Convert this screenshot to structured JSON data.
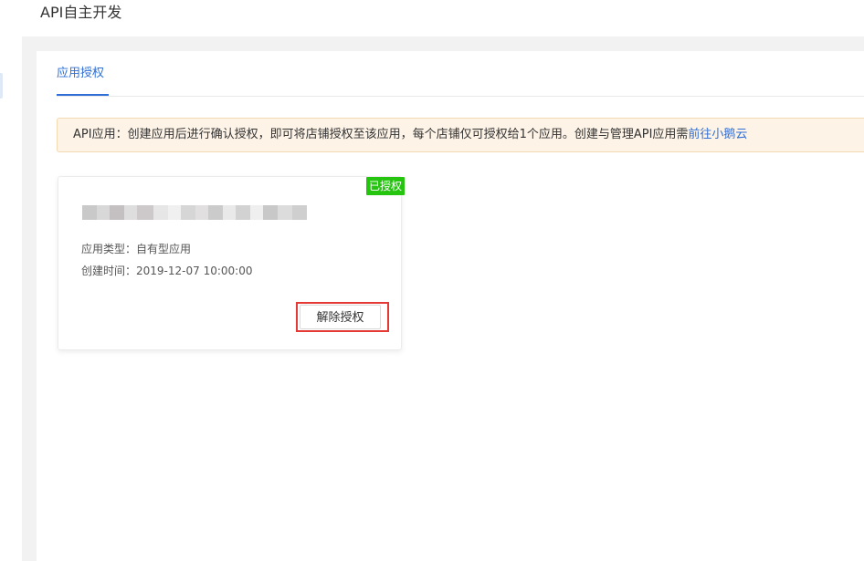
{
  "page": {
    "title": "API自主开发"
  },
  "tabs": [
    {
      "label": "应用授权",
      "active": true
    }
  ],
  "notice": {
    "text": "API应用：创建应用后进行确认授权，即可将店铺授权至该应用，每个店铺仅可授权给1个应用。创建与管理API应用需",
    "link_text": "前往小鹅云"
  },
  "app_card": {
    "status_badge": "已授权",
    "type_label": "应用类型：",
    "type_value": "自有型应用",
    "time_label": "创建时间：",
    "time_value": "2019-12-07 10:00:00",
    "revoke_label": "解除授权"
  },
  "colors": {
    "accent": "#2f6fd6",
    "badge_green": "#25c40f",
    "notice_bg": "#fdf3e7",
    "highlight_red": "#e53935"
  }
}
